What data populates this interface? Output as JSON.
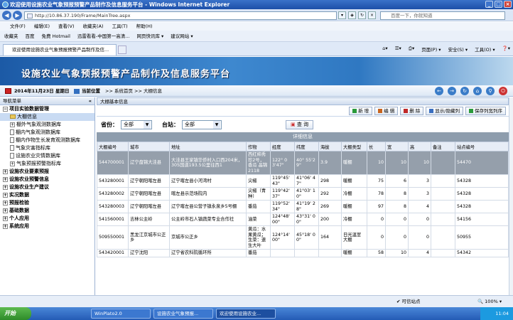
{
  "window": {
    "title": "欢迎使用设施农业气象预报预警产品制作及信息服务平台 - Windows Internet Explorer"
  },
  "address": {
    "url": "http://10.86.37.190/Frame/MainTree.aspx",
    "search_placeholder": "百度一下，你就知道"
  },
  "menu": [
    "文件(F)",
    "编辑(E)",
    "查看(V)",
    "收藏夹(A)",
    "工具(T)",
    "帮助(H)"
  ],
  "favorites": [
    "收藏夹",
    "百度",
    "免费 Hotmail",
    "迅雷看看-中国第一高清...",
    "网页快讯库 ▾",
    "建议网站 ▾"
  ],
  "tab": {
    "label": "欢迎使用设施农业气象预报预警产品制作及信..."
  },
  "commands": [
    "页面(P) ▾",
    "安全(S) ▾",
    "工具(O) ▾",
    "❓▾"
  ],
  "banner": {
    "title": "设施农业气象预报预警产品制作及信息服务平台"
  },
  "crumb": {
    "date": "2014年11月23日 星期日",
    "position_label": "当前位置",
    "path": ">> 系统首页 >> 大棚信息"
  },
  "sidebar": {
    "header": "导航菜单",
    "collapse": "«",
    "items": [
      {
        "label": "项目实验数据管理",
        "level": 0,
        "icon": "minus"
      },
      {
        "label": "大棚信息",
        "level": 1,
        "icon": "folder",
        "selected": true
      },
      {
        "label": "棚外气象观测数据库",
        "level": 1,
        "icon": "plus"
      },
      {
        "label": "棚内气象观测数据库",
        "level": 1,
        "icon": "doc"
      },
      {
        "label": "棚内作物生长发育观测数据库",
        "level": 1,
        "icon": "doc"
      },
      {
        "label": "气象灾害指标库",
        "level": 1,
        "icon": "doc"
      },
      {
        "label": "设施农业灾情数据库",
        "level": 1,
        "icon": "doc"
      },
      {
        "label": "气象预报预警指标库",
        "level": 1,
        "icon": "plus"
      },
      {
        "label": "设施农业要素预报",
        "level": 0,
        "icon": "plus"
      },
      {
        "label": "设施农业预警信息",
        "level": 0,
        "icon": "plus"
      },
      {
        "label": "设施农业生产建议",
        "level": 0,
        "icon": "plus"
      },
      {
        "label": "实况数据",
        "level": 0,
        "icon": "plus"
      },
      {
        "label": "预报检验",
        "level": 0,
        "icon": "plus"
      },
      {
        "label": "基础数据",
        "level": 0,
        "icon": "plus"
      },
      {
        "label": "个人应用",
        "level": 0,
        "icon": "plus"
      },
      {
        "label": "系统应用",
        "level": 0,
        "icon": "plus"
      }
    ]
  },
  "panel": {
    "title": "大棚基本信息"
  },
  "toolbar": {
    "buttons": [
      "新 增",
      "编 辑",
      "删 除",
      "显示/隐藏列",
      "保存列宽列序"
    ],
    "colors": [
      "#2a9a3a",
      "#c8641e",
      "#c02828",
      "#3a6fc0",
      "#2a9a3a"
    ]
  },
  "filter": {
    "province_label": "省份：",
    "province_value": "全部",
    "station_label": "台站：",
    "station_value": "全部",
    "query": "查 询"
  },
  "detail": {
    "header": "详细信息"
  },
  "table": {
    "columns": [
      "大棚编号",
      "城市",
      "地址",
      "作物",
      "经度",
      "纬度",
      "海拔",
      "大棚类型",
      "长",
      "宽",
      "高",
      "备注",
      "站点编号"
    ],
    "rows": [
      [
        "544700001",
        "辽宁盘锦大洼县",
        "大洼县王家镇华侨村入口西204米，305国道193.5公里往西1",
        "西红柿秀珍2号，香瓜 晶锦2118",
        "122° 03'47\"",
        "40° 55'29\"",
        "3.9",
        "暖棚",
        "10",
        "10",
        "10",
        "",
        "54470"
      ],
      [
        "543280001",
        "辽宁朝阳喀左县",
        "辽宁喀左县小河湾村",
        "尖椒",
        "119°45' 43\"",
        "41°06' 47\"",
        "298",
        "暖棚",
        "75",
        "6",
        "3",
        "",
        "54328"
      ],
      [
        "543280002",
        "辽宁朝阳喀左县",
        "喀左县示范场院内",
        "尖椒（青种）",
        "119°42' 37\"",
        "41°03' 10\"",
        "292",
        "冷棚",
        "78",
        "8",
        "3",
        "",
        "54328"
      ],
      [
        "543280003",
        "辽宁朝阳喀左县",
        "辽宁喀左县公营子镇永泉乡5号棚",
        "番茄",
        "119°52' 34\"",
        "41°19' 28\"",
        "269",
        "暖棚",
        "97",
        "8",
        "4",
        "",
        "54328"
      ],
      [
        "541560001",
        "吉林公主岭",
        "公主岭市石人镇蔬菜专业合作社",
        "油菜",
        "124°48' 00\"",
        "43°31' 00\"",
        "200",
        "冷棚",
        "0",
        "0",
        "0",
        "",
        "54156"
      ],
      [
        "509550001",
        "黑龙江京城市公正乡",
        "京城市公正乡",
        "黄瓜：水果黄瓜；生菜：速生大叶",
        "124°14' 00\"",
        "45°18' 00\"",
        "164",
        "日光温室大棚",
        "0",
        "0",
        "0",
        "",
        "50955"
      ],
      [
        "543420001",
        "辽宁沈阳",
        "辽宁省农科院循环所",
        "番茄",
        "",
        "",
        "",
        "暖棚",
        "58",
        "10",
        "4",
        "",
        "54342"
      ]
    ]
  },
  "status": {
    "trust": "可信站点",
    "zoom": "100%"
  },
  "taskbar": {
    "start": "开始",
    "tasks": [
      "WinPlato2.0",
      "设施农业气象预报...",
      "欢迎使用设施农业..."
    ],
    "time": "11:04"
  }
}
